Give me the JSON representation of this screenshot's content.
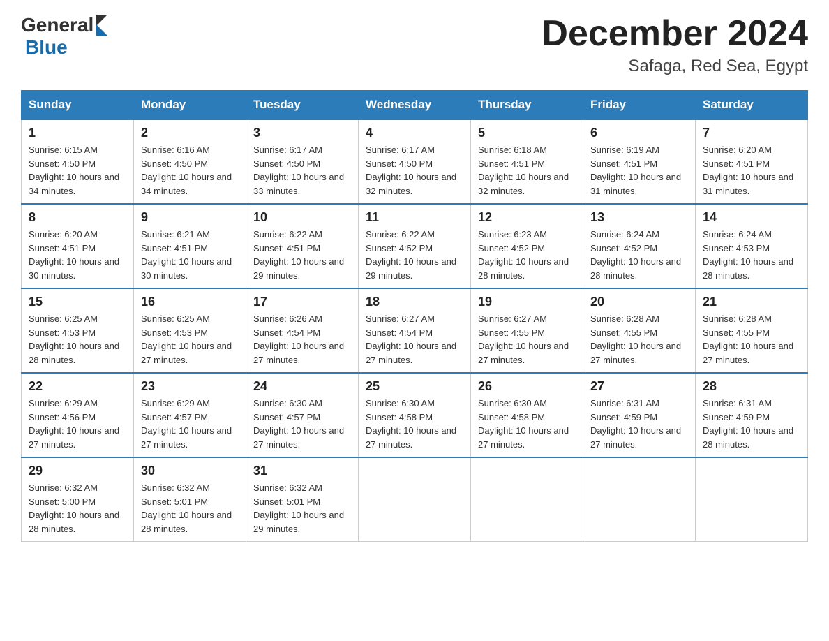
{
  "header": {
    "logo": {
      "general": "General",
      "blue": "Blue",
      "arrow_color": "#1a6baa"
    },
    "title": "December 2024",
    "location": "Safaga, Red Sea, Egypt"
  },
  "calendar": {
    "days_of_week": [
      "Sunday",
      "Monday",
      "Tuesday",
      "Wednesday",
      "Thursday",
      "Friday",
      "Saturday"
    ],
    "weeks": [
      [
        {
          "day": "1",
          "sunrise": "6:15 AM",
          "sunset": "4:50 PM",
          "daylight": "10 hours and 34 minutes."
        },
        {
          "day": "2",
          "sunrise": "6:16 AM",
          "sunset": "4:50 PM",
          "daylight": "10 hours and 34 minutes."
        },
        {
          "day": "3",
          "sunrise": "6:17 AM",
          "sunset": "4:50 PM",
          "daylight": "10 hours and 33 minutes."
        },
        {
          "day": "4",
          "sunrise": "6:17 AM",
          "sunset": "4:50 PM",
          "daylight": "10 hours and 32 minutes."
        },
        {
          "day": "5",
          "sunrise": "6:18 AM",
          "sunset": "4:51 PM",
          "daylight": "10 hours and 32 minutes."
        },
        {
          "day": "6",
          "sunrise": "6:19 AM",
          "sunset": "4:51 PM",
          "daylight": "10 hours and 31 minutes."
        },
        {
          "day": "7",
          "sunrise": "6:20 AM",
          "sunset": "4:51 PM",
          "daylight": "10 hours and 31 minutes."
        }
      ],
      [
        {
          "day": "8",
          "sunrise": "6:20 AM",
          "sunset": "4:51 PM",
          "daylight": "10 hours and 30 minutes."
        },
        {
          "day": "9",
          "sunrise": "6:21 AM",
          "sunset": "4:51 PM",
          "daylight": "10 hours and 30 minutes."
        },
        {
          "day": "10",
          "sunrise": "6:22 AM",
          "sunset": "4:51 PM",
          "daylight": "10 hours and 29 minutes."
        },
        {
          "day": "11",
          "sunrise": "6:22 AM",
          "sunset": "4:52 PM",
          "daylight": "10 hours and 29 minutes."
        },
        {
          "day": "12",
          "sunrise": "6:23 AM",
          "sunset": "4:52 PM",
          "daylight": "10 hours and 28 minutes."
        },
        {
          "day": "13",
          "sunrise": "6:24 AM",
          "sunset": "4:52 PM",
          "daylight": "10 hours and 28 minutes."
        },
        {
          "day": "14",
          "sunrise": "6:24 AM",
          "sunset": "4:53 PM",
          "daylight": "10 hours and 28 minutes."
        }
      ],
      [
        {
          "day": "15",
          "sunrise": "6:25 AM",
          "sunset": "4:53 PM",
          "daylight": "10 hours and 28 minutes."
        },
        {
          "day": "16",
          "sunrise": "6:25 AM",
          "sunset": "4:53 PM",
          "daylight": "10 hours and 27 minutes."
        },
        {
          "day": "17",
          "sunrise": "6:26 AM",
          "sunset": "4:54 PM",
          "daylight": "10 hours and 27 minutes."
        },
        {
          "day": "18",
          "sunrise": "6:27 AM",
          "sunset": "4:54 PM",
          "daylight": "10 hours and 27 minutes."
        },
        {
          "day": "19",
          "sunrise": "6:27 AM",
          "sunset": "4:55 PM",
          "daylight": "10 hours and 27 minutes."
        },
        {
          "day": "20",
          "sunrise": "6:28 AM",
          "sunset": "4:55 PM",
          "daylight": "10 hours and 27 minutes."
        },
        {
          "day": "21",
          "sunrise": "6:28 AM",
          "sunset": "4:55 PM",
          "daylight": "10 hours and 27 minutes."
        }
      ],
      [
        {
          "day": "22",
          "sunrise": "6:29 AM",
          "sunset": "4:56 PM",
          "daylight": "10 hours and 27 minutes."
        },
        {
          "day": "23",
          "sunrise": "6:29 AM",
          "sunset": "4:57 PM",
          "daylight": "10 hours and 27 minutes."
        },
        {
          "day": "24",
          "sunrise": "6:30 AM",
          "sunset": "4:57 PM",
          "daylight": "10 hours and 27 minutes."
        },
        {
          "day": "25",
          "sunrise": "6:30 AM",
          "sunset": "4:58 PM",
          "daylight": "10 hours and 27 minutes."
        },
        {
          "day": "26",
          "sunrise": "6:30 AM",
          "sunset": "4:58 PM",
          "daylight": "10 hours and 27 minutes."
        },
        {
          "day": "27",
          "sunrise": "6:31 AM",
          "sunset": "4:59 PM",
          "daylight": "10 hours and 27 minutes."
        },
        {
          "day": "28",
          "sunrise": "6:31 AM",
          "sunset": "4:59 PM",
          "daylight": "10 hours and 28 minutes."
        }
      ],
      [
        {
          "day": "29",
          "sunrise": "6:32 AM",
          "sunset": "5:00 PM",
          "daylight": "10 hours and 28 minutes."
        },
        {
          "day": "30",
          "sunrise": "6:32 AM",
          "sunset": "5:01 PM",
          "daylight": "10 hours and 28 minutes."
        },
        {
          "day": "31",
          "sunrise": "6:32 AM",
          "sunset": "5:01 PM",
          "daylight": "10 hours and 29 minutes."
        },
        null,
        null,
        null,
        null
      ]
    ]
  }
}
